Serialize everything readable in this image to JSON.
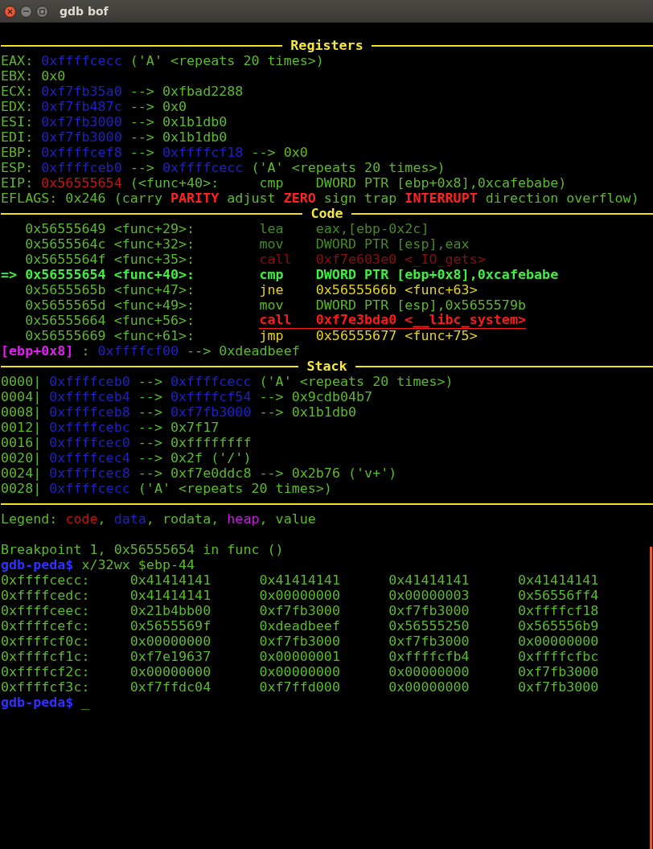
{
  "window": {
    "title": "gdb bof"
  },
  "terminal": {
    "lines": [
      {
        "kind": "blank"
      },
      {
        "kind": "header",
        "title": "Registers"
      },
      {
        "kind": "text",
        "segments": [
          {
            "text": "EAX: ",
            "kind": "label"
          },
          {
            "text": "0xffffcecc",
            "kind": "data"
          },
          {
            "text": " ('A' <repeats 20 times>)",
            "kind": "value"
          }
        ]
      },
      {
        "kind": "text",
        "segments": [
          {
            "text": "EBX: ",
            "kind": "label"
          },
          {
            "text": "0x0",
            "kind": "value"
          }
        ]
      },
      {
        "kind": "text",
        "segments": [
          {
            "text": "ECX: ",
            "kind": "label"
          },
          {
            "text": "0xf7fb35a0",
            "kind": "data"
          },
          {
            "text": " --> 0xfbad2288",
            "kind": "value"
          }
        ]
      },
      {
        "kind": "text",
        "segments": [
          {
            "text": "EDX: ",
            "kind": "label"
          },
          {
            "text": "0xf7fb487c",
            "kind": "data"
          },
          {
            "text": " --> 0x0",
            "kind": "value"
          }
        ]
      },
      {
        "kind": "text",
        "segments": [
          {
            "text": "ESI: ",
            "kind": "label"
          },
          {
            "text": "0xf7fb3000",
            "kind": "data"
          },
          {
            "text": " --> 0x1b1db0",
            "kind": "value"
          }
        ]
      },
      {
        "kind": "text",
        "segments": [
          {
            "text": "EDI: ",
            "kind": "label"
          },
          {
            "text": "0xf7fb3000",
            "kind": "data"
          },
          {
            "text": " --> 0x1b1db0",
            "kind": "value"
          }
        ]
      },
      {
        "kind": "text",
        "segments": [
          {
            "text": "EBP: ",
            "kind": "label"
          },
          {
            "text": "0xffffcef8",
            "kind": "data"
          },
          {
            "text": " --> ",
            "kind": "value"
          },
          {
            "text": "0xffffcf18",
            "kind": "data"
          },
          {
            "text": " --> 0x0",
            "kind": "value"
          }
        ]
      },
      {
        "kind": "text",
        "segments": [
          {
            "text": "ESP: ",
            "kind": "label"
          },
          {
            "text": "0xffffceb0",
            "kind": "data"
          },
          {
            "text": " --> ",
            "kind": "value"
          },
          {
            "text": "0xffffcecc",
            "kind": "data"
          },
          {
            "text": " ('A' <repeats 20 times>)",
            "kind": "value"
          }
        ]
      },
      {
        "kind": "text",
        "segments": [
          {
            "text": "EIP: ",
            "kind": "label"
          },
          {
            "text": "0x56555654",
            "kind": "code"
          },
          {
            "text": " (<func+40>:     cmp    DWORD PTR [ebp+0x8],0xcafebabe)",
            "kind": "value"
          }
        ]
      },
      {
        "kind": "text",
        "segments": [
          {
            "text": "EFLAGS: 0x246 (carry ",
            "kind": "value"
          },
          {
            "text": "PARITY",
            "kind": "flag"
          },
          {
            "text": " adjust ",
            "kind": "value"
          },
          {
            "text": "ZERO",
            "kind": "flag"
          },
          {
            "text": " sign trap ",
            "kind": "value"
          },
          {
            "text": "INTERRUPT",
            "kind": "flag"
          },
          {
            "text": " direction overflow)",
            "kind": "value"
          }
        ]
      },
      {
        "kind": "header",
        "title": "Code"
      },
      {
        "kind": "listing",
        "rows": [
          {
            "kind": "executed",
            "location": "0x56555649 <func+29>:",
            "mnemonic": "lea",
            "operands": "eax,[ebp-0x2c]"
          },
          {
            "kind": "executed",
            "location": "0x5655564c <func+32>:",
            "mnemonic": "mov",
            "operands": "DWORD PTR [esp],eax"
          },
          {
            "kind": "executed-call",
            "location": "0x5655564f <func+35>:",
            "mnemonic": "call",
            "operands": "0xf7e603e0 <_IO_gets>"
          },
          {
            "kind": "current",
            "marker": "=>",
            "location": "0x56555654 <func+40>:",
            "mnemonic": "cmp",
            "operands": "DWORD PTR [ebp+0x8],0xcafebabe"
          },
          {
            "kind": "jump",
            "location": "0x5655565b <func+47>:",
            "mnemonic": "jne",
            "operands": "0x5655566b <func+63>"
          },
          {
            "kind": "pending",
            "location": "0x5655565d <func+49>:",
            "mnemonic": "mov",
            "operands": "DWORD PTR [esp],0x5655579b"
          },
          {
            "kind": "call",
            "location": "0x56555664 <func+56>:",
            "mnemonic": "call",
            "operands": "0xf7e3bda0 <__libc_system>"
          },
          {
            "kind": "jump",
            "location": "0x56555669 <func+61>:",
            "mnemonic": "jmp",
            "operands": "0x56555677 <func+75>"
          }
        ]
      },
      {
        "kind": "text",
        "segments": [
          {
            "text": "[ebp+0x8]",
            "kind": "heap-bold"
          },
          {
            "text": " : ",
            "kind": "value"
          },
          {
            "text": "0xffffcf00",
            "kind": "data"
          },
          {
            "text": " --> 0xdeadbeef",
            "kind": "value"
          }
        ]
      },
      {
        "kind": "header",
        "title": "Stack"
      },
      {
        "kind": "text",
        "segments": [
          {
            "text": "0000| ",
            "kind": "offset"
          },
          {
            "text": "0xffffceb0",
            "kind": "data"
          },
          {
            "text": " --> ",
            "kind": "value"
          },
          {
            "text": "0xffffcecc",
            "kind": "data"
          },
          {
            "text": " ('A' <repeats 20 times>)",
            "kind": "value"
          }
        ]
      },
      {
        "kind": "text",
        "segments": [
          {
            "text": "0004| ",
            "kind": "offset"
          },
          {
            "text": "0xffffceb4",
            "kind": "data"
          },
          {
            "text": " --> ",
            "kind": "value"
          },
          {
            "text": "0xffffcf54",
            "kind": "data"
          },
          {
            "text": " --> 0x9cdb04b7",
            "kind": "value"
          }
        ]
      },
      {
        "kind": "text",
        "segments": [
          {
            "text": "0008| ",
            "kind": "offset"
          },
          {
            "text": "0xffffceb8",
            "kind": "data"
          },
          {
            "text": " --> ",
            "kind": "value"
          },
          {
            "text": "0xf7fb3000",
            "kind": "data"
          },
          {
            "text": " --> 0x1b1db0",
            "kind": "value"
          }
        ]
      },
      {
        "kind": "text",
        "segments": [
          {
            "text": "0012| ",
            "kind": "offset"
          },
          {
            "text": "0xffffcebc",
            "kind": "data"
          },
          {
            "text": " --> 0x7f17",
            "kind": "value"
          }
        ]
      },
      {
        "kind": "text",
        "segments": [
          {
            "text": "0016| ",
            "kind": "offset"
          },
          {
            "text": "0xffffcec0",
            "kind": "data"
          },
          {
            "text": " --> 0xffffffff",
            "kind": "value"
          }
        ]
      },
      {
        "kind": "text",
        "segments": [
          {
            "text": "0020| ",
            "kind": "offset"
          },
          {
            "text": "0xffffcec4",
            "kind": "data"
          },
          {
            "text": " --> 0x2f ('/')",
            "kind": "value"
          }
        ]
      },
      {
        "kind": "text",
        "segments": [
          {
            "text": "0024| ",
            "kind": "offset"
          },
          {
            "text": "0xffffcec8",
            "kind": "data"
          },
          {
            "text": " --> 0xf7e0ddc8 --> 0x2b76 ('v+')",
            "kind": "value"
          }
        ]
      },
      {
        "kind": "text",
        "segments": [
          {
            "text": "0028| ",
            "kind": "offset"
          },
          {
            "text": "0xffffcecc",
            "kind": "data"
          },
          {
            "text": " ('A' <repeats 20 times>)",
            "kind": "value"
          }
        ]
      },
      {
        "kind": "rule"
      },
      {
        "kind": "text",
        "segments": [
          {
            "text": "Legend: ",
            "kind": "value"
          },
          {
            "text": "code",
            "kind": "code"
          },
          {
            "text": ", ",
            "kind": "value"
          },
          {
            "text": "data",
            "kind": "data"
          },
          {
            "text": ", rodata, ",
            "kind": "value"
          },
          {
            "text": "heap",
            "kind": "heap"
          },
          {
            "text": ", value",
            "kind": "value"
          }
        ]
      },
      {
        "kind": "blank"
      },
      {
        "kind": "text",
        "segments": [
          {
            "text": "Breakpoint 1, 0x56555654 in func ()",
            "kind": "value"
          }
        ]
      },
      {
        "kind": "text",
        "segments": [
          {
            "text": "gdb-peda$",
            "kind": "prompt"
          },
          {
            "text": " x/32wx $ebp-44",
            "kind": "value"
          }
        ]
      },
      {
        "kind": "dump",
        "address": "0xffffcecc:",
        "values": [
          "0x41414141",
          "0x41414141",
          "0x41414141",
          "0x41414141"
        ]
      },
      {
        "kind": "dump",
        "address": "0xffffcedc:",
        "values": [
          "0x41414141",
          "0x00000000",
          "0x00000003",
          "0x56556ff4"
        ]
      },
      {
        "kind": "dump",
        "address": "0xffffceec:",
        "values": [
          "0x21b4bb00",
          "0xf7fb3000",
          "0xf7fb3000",
          "0xffffcf18"
        ]
      },
      {
        "kind": "dump",
        "address": "0xffffcefc:",
        "values": [
          "0x5655569f",
          "0xdeadbeef",
          "0x56555250",
          "0x565556b9"
        ]
      },
      {
        "kind": "dump",
        "address": "0xffffcf0c:",
        "values": [
          "0x00000000",
          "0xf7fb3000",
          "0xf7fb3000",
          "0x00000000"
        ]
      },
      {
        "kind": "dump",
        "address": "0xffffcf1c:",
        "values": [
          "0xf7e19637",
          "0x00000001",
          "0xffffcfb4",
          "0xffffcfbc"
        ]
      },
      {
        "kind": "dump",
        "address": "0xffffcf2c:",
        "values": [
          "0x00000000",
          "0x00000000",
          "0x00000000",
          "0xf7fb3000"
        ]
      },
      {
        "kind": "dump",
        "address": "0xffffcf3c:",
        "values": [
          "0xf7ffdc04",
          "0xf7ffd000",
          "0x00000000",
          "0xf7fb3000"
        ]
      },
      {
        "kind": "text",
        "segments": [
          {
            "text": "gdb-peda$",
            "kind": "prompt"
          },
          {
            "text": " _",
            "kind": "value"
          }
        ]
      }
    ]
  }
}
